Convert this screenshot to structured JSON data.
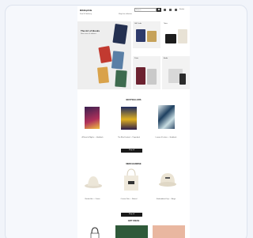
{
  "header": {
    "logo": "Bibliophile",
    "search_placeholder": "Search",
    "links": [
      "Sign in",
      "Wishlist",
      "Basket"
    ]
  },
  "subnav": {
    "left": "Free UK delivery",
    "center": "Shop the collection"
  },
  "hero": {
    "title": "The Art of Books",
    "subtitle": "New covers & editions"
  },
  "tiles": [
    {
      "label": "Gift Cards"
    },
    {
      "label": "Totes"
    },
    {
      "label": "Prints"
    },
    {
      "label": "Audio"
    }
  ],
  "sections": [
    {
      "title": "BESTSELLERS",
      "items": [
        "A Novel of Nights — Hardback",
        "The Blue Festival — Paperback",
        "Leaves & Letters — Hardback"
      ],
      "button": "Shop all"
    },
    {
      "title": "MERCHANDISE",
      "items": [
        "Bucket Hat — Cream",
        "Canvas Tote — Natural",
        "Embroidered Cap — Beige"
      ],
      "button": "Shop all"
    },
    {
      "title": "GIFT IDEAS"
    }
  ],
  "colors": {
    "accent_dark": "#1a1a1a",
    "page_bg": "#ffffff",
    "frame_bg": "#f6f8fc"
  }
}
